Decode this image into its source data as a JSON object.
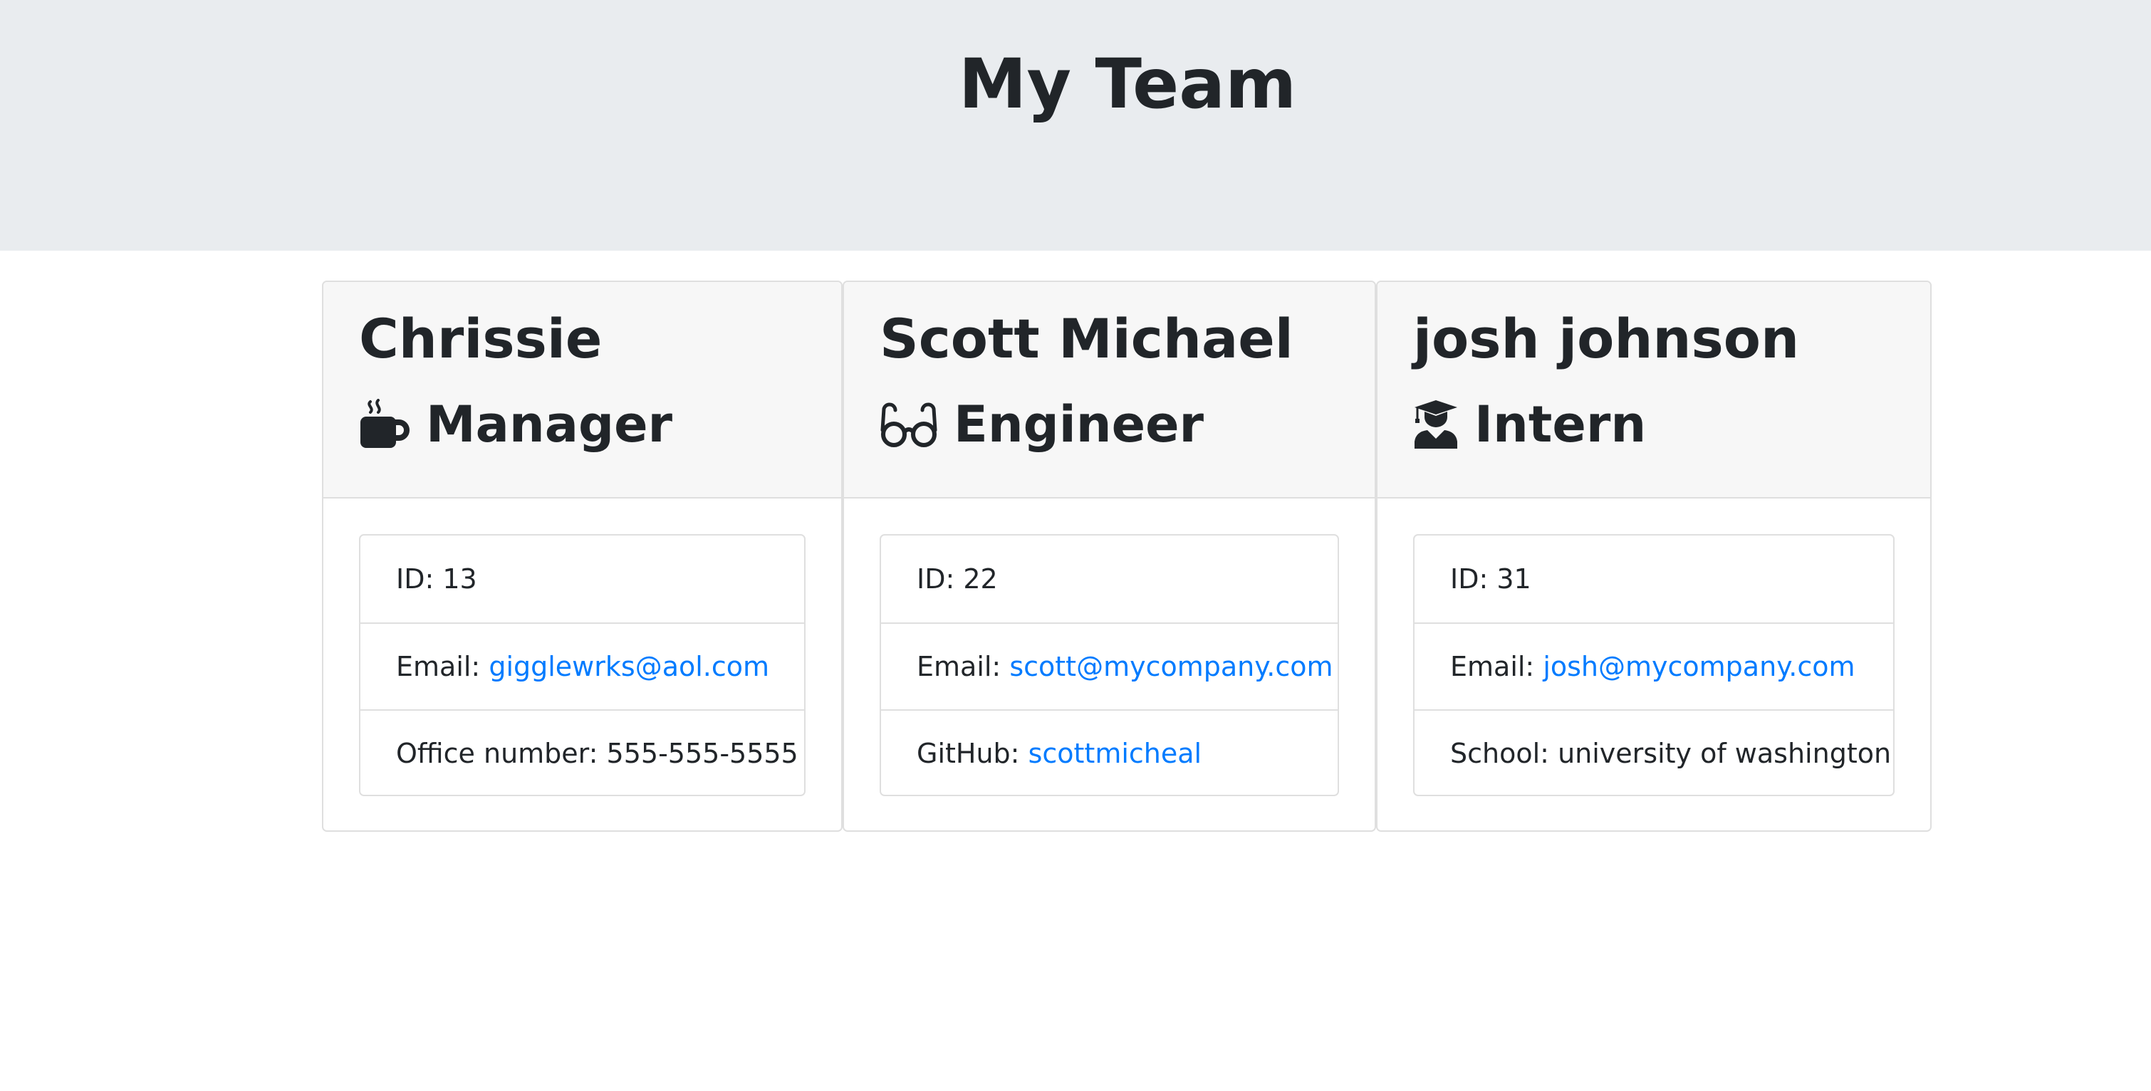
{
  "header": {
    "title": "My Team"
  },
  "colors": {
    "link": "#007bff",
    "jumbotron": "#e9ecef",
    "card_header": "#f7f7f7",
    "text": "#212529"
  },
  "cards": [
    {
      "name": "Chrissie",
      "role": "Manager",
      "role_icon": "mug-hot-icon",
      "id_label": "ID: 13",
      "email_label": "Email: ",
      "email": "gigglewrks@aol.com",
      "extra_label": "Office number: ",
      "extra_value": "555-555-5555"
    },
    {
      "name": "Scott Michael",
      "role": "Engineer",
      "role_icon": "glasses-icon",
      "id_label": "ID: 22",
      "email_label": "Email: ",
      "email": "scott@mycompany.com",
      "extra_label": "GitHub: ",
      "extra_value": "scottmicheal"
    },
    {
      "name": "josh johnson",
      "role": "Intern",
      "role_icon": "graduate-icon",
      "id_label": "ID: 31",
      "email_label": "Email: ",
      "email": "josh@mycompany.com",
      "extra_label": "School: ",
      "extra_value": "university of washington"
    }
  ]
}
